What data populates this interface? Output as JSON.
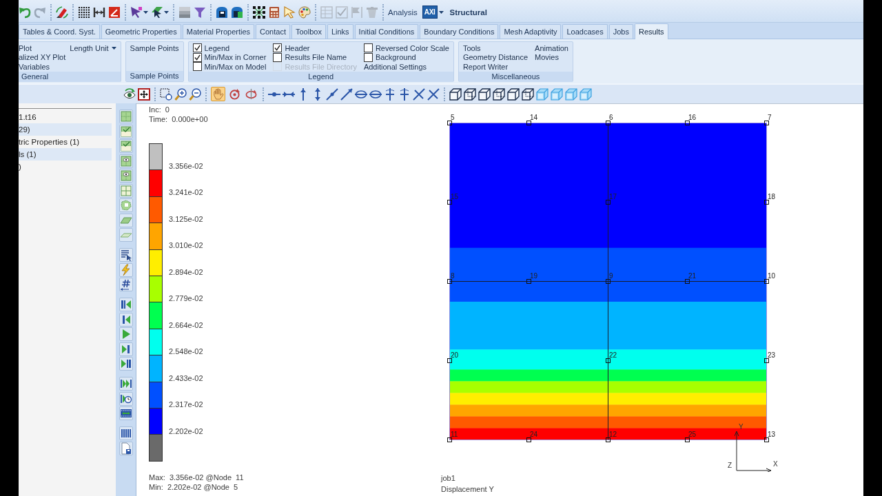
{
  "toolbar": {
    "buttons": [
      {
        "disabled": false
      },
      {
        "disabled": false
      },
      {
        "disabled": false
      },
      {
        "disabled": false
      },
      {
        "disabled": false
      },
      {
        "disabled": false
      },
      {
        "disabled": false
      },
      {
        "disabled": false
      },
      {
        "disabled": false
      },
      {
        "disabled": false
      },
      {
        "disabled": false
      },
      {
        "disabled": false
      },
      {
        "disabled": false
      },
      {
        "disabled": false
      },
      {
        "disabled": false
      },
      {
        "disabled": false
      },
      {
        "disabled": true
      },
      {
        "disabled": true
      },
      {
        "disabled": true
      },
      {
        "disabled": true
      }
    ],
    "analysis_label": "Analysis",
    "analysis_mode": "AXI",
    "analysis_type": "Structural"
  },
  "tabs": [
    {
      "label": "Tables & Coord. Syst.",
      "selected": false
    },
    {
      "label": "Geometric Properties",
      "selected": false
    },
    {
      "label": "Material Properties",
      "selected": false
    },
    {
      "label": "Contact",
      "selected": false
    },
    {
      "label": "Toolbox",
      "selected": false
    },
    {
      "label": "Links",
      "selected": false
    },
    {
      "label": "Initial Conditions",
      "selected": false
    },
    {
      "label": "Boundary Conditions",
      "selected": false
    },
    {
      "label": "Mesh Adaptivity",
      "selected": false
    },
    {
      "label": "Loadcases",
      "selected": false
    },
    {
      "label": "Jobs",
      "selected": false
    },
    {
      "label": "Results",
      "selected": true
    }
  ],
  "ribbon": {
    "groups": [
      {
        "title": "General",
        "columns": [
          [
            {
              "kind": "button",
              "label": "Plot"
            },
            {
              "kind": "button",
              "label": "alized XY Plot"
            },
            {
              "kind": "button",
              "label": "Variables"
            }
          ],
          [
            {
              "kind": "dropdown",
              "label": "Length Unit"
            }
          ]
        ]
      },
      {
        "title": "Sample Points",
        "columns": [
          [
            {
              "kind": "button",
              "label": "Sample Points"
            }
          ]
        ]
      },
      {
        "title": "Legend",
        "columns": [
          [
            {
              "kind": "checkbox",
              "label": "Legend",
              "checked": true,
              "disabled": false
            },
            {
              "kind": "checkbox",
              "label": "Min/Max in Corner",
              "checked": true,
              "disabled": false
            },
            {
              "kind": "checkbox",
              "label": "Min/Max on Model",
              "checked": false,
              "disabled": false
            }
          ],
          [
            {
              "kind": "checkbox",
              "label": "Header",
              "checked": true,
              "disabled": false
            },
            {
              "kind": "checkbox",
              "label": "Results File Name",
              "checked": false,
              "disabled": false
            },
            {
              "kind": "checkbox",
              "label": "Results File Directory",
              "checked": false,
              "disabled": true
            }
          ],
          [
            {
              "kind": "checkbox",
              "label": "Reversed Color Scale",
              "checked": false,
              "disabled": false
            },
            {
              "kind": "checkbox",
              "label": "Background",
              "checked": false,
              "disabled": false
            },
            {
              "kind": "button",
              "label": "Additional Settings"
            }
          ]
        ]
      },
      {
        "title": "Miscellaneous",
        "columns": [
          [
            {
              "kind": "button",
              "label": "Tools"
            },
            {
              "kind": "button",
              "label": "Geometry Distance"
            },
            {
              "kind": "button",
              "label": "Report Writer"
            }
          ],
          [
            {
              "kind": "button",
              "label": "Animation"
            },
            {
              "kind": "button",
              "label": "Movies"
            }
          ]
        ]
      }
    ]
  },
  "view_modes": [
    {
      "selected": true
    },
    {
      "selected": false
    },
    {
      "selected": false
    }
  ],
  "model_tree": {
    "items": [
      "1.t16",
      "29)",
      "tric Properties (1)",
      "ls (1)",
      ")"
    ]
  },
  "viewport": {
    "header": [
      "Inc:  0",
      "Time:  0.000e+00"
    ],
    "legend": {
      "swatches": [
        {
          "color": "#c0c0c0"
        },
        {
          "color": "#ff0000"
        },
        {
          "color": "#ff5a00"
        },
        {
          "color": "#ffa500"
        },
        {
          "color": "#ffee00"
        },
        {
          "color": "#a8ff00"
        },
        {
          "color": "#00ff50"
        },
        {
          "color": "#00ffee"
        },
        {
          "color": "#00b4ff"
        },
        {
          "color": "#0050ff"
        },
        {
          "color": "#0000ff"
        },
        {
          "color": "#6a6a6a"
        }
      ],
      "labels": [
        "3.356e-02",
        "3.241e-02",
        "3.125e-02",
        "3.010e-02",
        "2.894e-02",
        "2.779e-02",
        "2.664e-02",
        "2.548e-02",
        "2.433e-02",
        "2.317e-02",
        "2.202e-02"
      ]
    },
    "min_max": [
      "Max:  3.356e-02 @Node  11",
      "Min:  2.202e-02 @Node  5"
    ],
    "job_info": [
      "job1",
      "Displacement Y"
    ],
    "model": {
      "nodes": [
        "5",
        "14",
        "6",
        "16",
        "7",
        "15",
        "17",
        "18",
        "8",
        "19",
        "9",
        "21",
        "10",
        "20",
        "22",
        "23",
        "11",
        "24",
        "12",
        "25",
        "13"
      ]
    },
    "axes": [
      "Y",
      "Z",
      "X"
    ]
  }
}
